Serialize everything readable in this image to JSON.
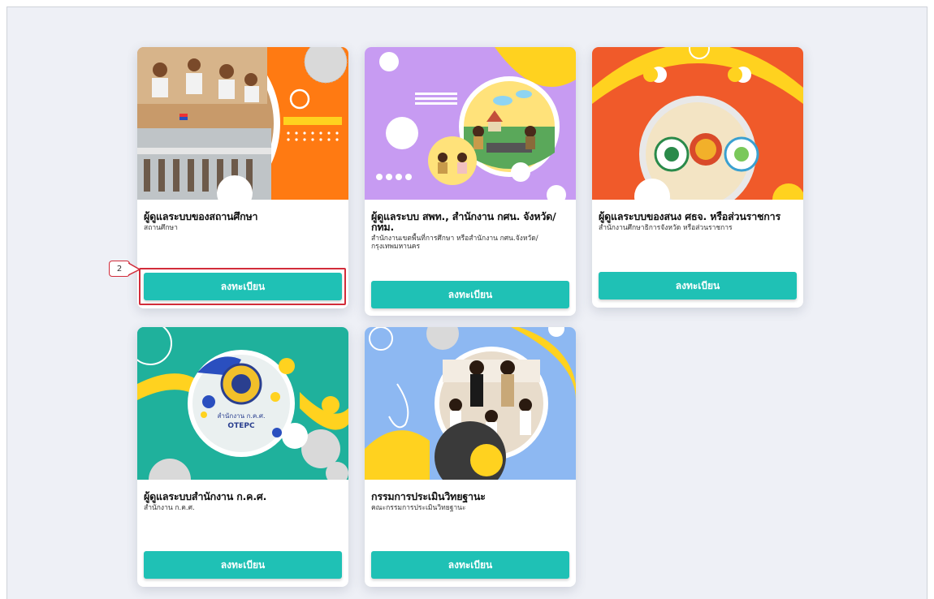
{
  "cards": [
    {
      "title": "ผู้ดูแลระบบของสถานศึกษา",
      "subtitle": "สถานศึกษา",
      "button_label": "ลงทะเบียน",
      "banner_color": "#ff7a12"
    },
    {
      "title": "ผู้ดูแลระบบ สพท., สำนักงาน กศน. จังหวัด/กทม.",
      "subtitle": "สำนักงานเขตพื้นที่การศึกษา หรือสำนักงาน กศน.จังหวัด/กรุงเทพมหานคร",
      "button_label": "ลงทะเบียน",
      "banner_color": "#c79bf2"
    },
    {
      "title": "ผู้ดูแลระบบของสนง ศธจ. หรือส่วนราชการ",
      "subtitle": "สำนักงานศึกษาธิการจังหวัด หรือส่วนราชการ",
      "button_label": "ลงทะเบียน",
      "banner_color": "#f05a2a"
    },
    {
      "title": "ผู้ดูแลระบบสำนักงาน ก.ค.ศ.",
      "subtitle": "สำนักงาน ก.ค.ศ.",
      "button_label": "ลงทะเบียน",
      "banner_color": "#1fb19c",
      "logo_text": "สำนักงาน ก.ค.ศ.",
      "logo_caption": "OTEPC"
    },
    {
      "title": "กรรมการประเมินวิทยฐานะ",
      "subtitle": "คณะกรรมการประเมินวิทยฐานะ",
      "button_label": "ลงทะเบียน",
      "banner_color": "#8db8f2"
    }
  ],
  "annotation": {
    "step_number": "2",
    "color": "#d22c3a"
  },
  "colors": {
    "button": "#1fc1b5",
    "background": "#eef0f6",
    "accent_yellow": "#ffd21f"
  }
}
